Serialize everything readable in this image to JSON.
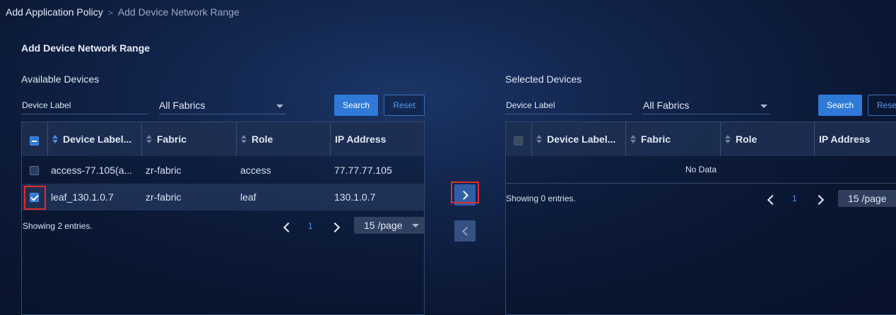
{
  "breadcrumb": {
    "parent": "Add Application Policy",
    "separator": ">",
    "current": "Add Device Network Range"
  },
  "section_title": "Add Device Network Range",
  "available": {
    "title": "Available Devices",
    "device_label_placeholder": "Device Label",
    "fabric_select": "All Fabrics",
    "search_label": "Search",
    "reset_label": "Reset",
    "columns": [
      "Device Label...",
      "Fabric",
      "Role",
      "IP Address"
    ],
    "rows": [
      {
        "label": "access-77.105(a...",
        "fabric": "zr-fabric",
        "role": "access",
        "ip": "77.77.77.105",
        "checked": false
      },
      {
        "label": "leaf_130.1.0.7",
        "fabric": "zr-fabric",
        "role": "leaf",
        "ip": "130.1.0.7",
        "checked": true
      }
    ],
    "footer": "Showing 2 entries.",
    "page": "1",
    "page_size": "15 /page"
  },
  "selected": {
    "title": "Selected Devices",
    "device_label_placeholder": "Device Label",
    "fabric_select": "All Fabrics",
    "search_label": "Search",
    "reset_label": "Rese",
    "columns": [
      "Device Label...",
      "Fabric",
      "Role",
      "IP Address"
    ],
    "empty_text": "No Data",
    "footer": "Showing 0 entries.",
    "page": "1",
    "page_size": "15 /page"
  },
  "colors": {
    "accent": "#2f7ad9",
    "highlight": "#e02b2b",
    "background": "#0b1733"
  },
  "icons": {
    "move_right": "chevron-right-icon",
    "move_left": "chevron-left-icon"
  }
}
